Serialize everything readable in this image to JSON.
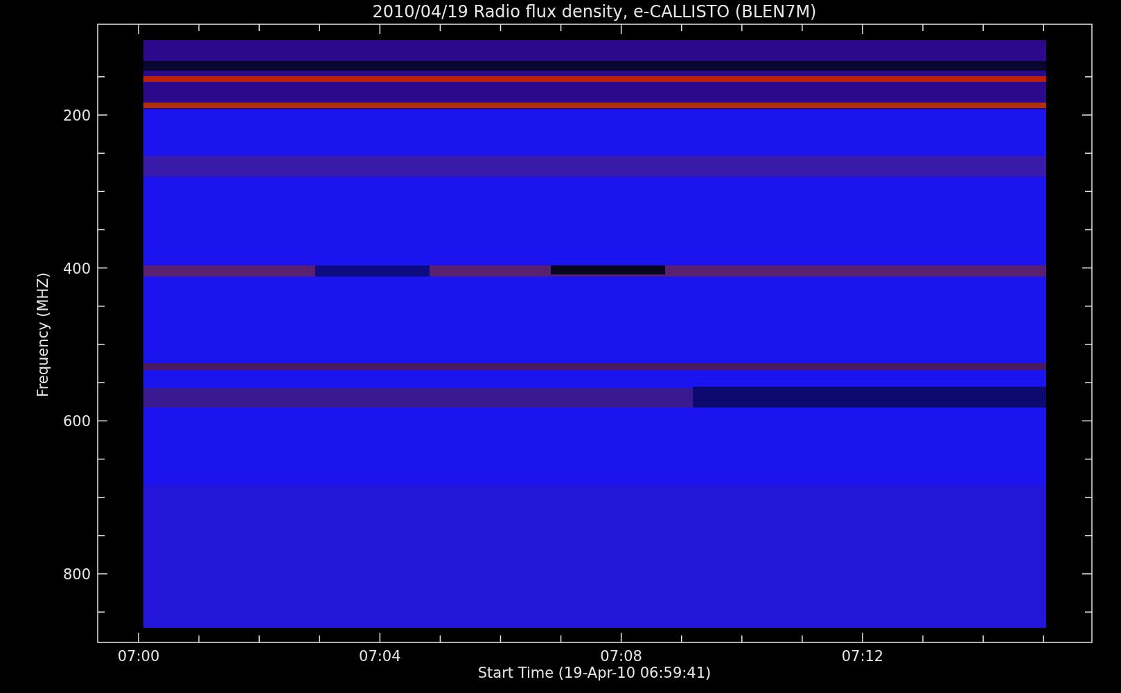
{
  "title": "2010/04/19  Radio flux density, e-CALLISTO (BLEN7M)",
  "y_axis": {
    "label": "Frequency (MHZ)",
    "tick_labels": [
      "200",
      "400",
      "600",
      "800"
    ]
  },
  "x_axis": {
    "label": "Start Time (19-Apr-10 06:59:41)",
    "tick_labels": [
      "07:00",
      "07:04",
      "07:08",
      "07:12"
    ]
  }
}
